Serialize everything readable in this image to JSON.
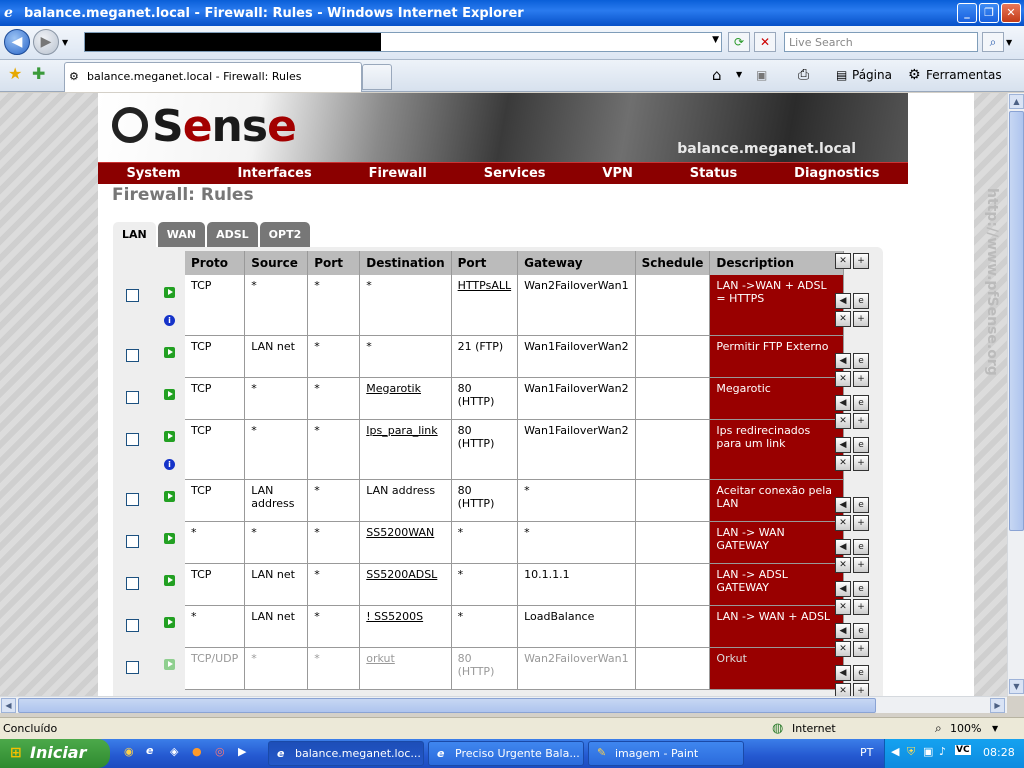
{
  "window": {
    "title": "balance.meganet.local - Firewall: Rules - Windows Internet Explorer",
    "search_placeholder": "Live Search",
    "tab_title": "balance.meganet.local - Firewall: Rules",
    "page_menu": "Página",
    "tools_menu": "Ferramentas"
  },
  "pfsense": {
    "logo_text": "pfSense",
    "hostname": "balance.meganet.local",
    "menu": [
      "System",
      "Interfaces",
      "Firewall",
      "Services",
      "VPN",
      "Status",
      "Diagnostics"
    ],
    "page_title": "Firewall: Rules",
    "watermark": "http://www.pfSense.org",
    "tabs": [
      "LAN",
      "WAN",
      "ADSL",
      "OPT2"
    ],
    "active_tab": "LAN",
    "columns": [
      "Proto",
      "Source",
      "Port",
      "Destination",
      "Port",
      "Gateway",
      "Schedule",
      "Description"
    ],
    "rules": [
      {
        "proto": "TCP",
        "source": "*",
        "sport": "*",
        "dest": "*",
        "dest_link": false,
        "dport": "HTTPsALL",
        "dport_link": true,
        "gateway": "Wan2FailoverWan1",
        "schedule": "",
        "desc": "LAN ->WAN + ADSL = HTTPS",
        "enabled": true,
        "info": true
      },
      {
        "proto": "TCP",
        "source": "LAN net",
        "sport": "*",
        "dest": "*",
        "dest_link": false,
        "dport": "21 (FTP)",
        "dport_link": false,
        "gateway": "Wan1FailoverWan2",
        "schedule": "",
        "desc": "Permitir FTP Externo",
        "enabled": true,
        "info": false
      },
      {
        "proto": "TCP",
        "source": "*",
        "sport": "*",
        "dest": "Megarotik",
        "dest_link": true,
        "dport": "80 (HTTP)",
        "dport_link": false,
        "gateway": "Wan1FailoverWan2",
        "schedule": "",
        "desc": "Megarotic",
        "enabled": true,
        "info": false
      },
      {
        "proto": "TCP",
        "source": "*",
        "sport": "*",
        "dest": "Ips_para_link",
        "dest_link": true,
        "dport": "80 (HTTP)",
        "dport_link": false,
        "gateway": "Wan1FailoverWan2",
        "schedule": "",
        "desc": "Ips redirecinados para um link",
        "enabled": true,
        "info": true
      },
      {
        "proto": "TCP",
        "source": "LAN address",
        "sport": "*",
        "dest": "LAN address",
        "dest_link": false,
        "dport": "80 (HTTP)",
        "dport_link": false,
        "gateway": "*",
        "schedule": "",
        "desc": "Aceitar conexão pela LAN",
        "enabled": true,
        "info": false
      },
      {
        "proto": "*",
        "source": "*",
        "sport": "*",
        "dest": "SS5200WAN",
        "dest_link": true,
        "dport": "*",
        "dport_link": false,
        "gateway": "*",
        "schedule": "",
        "desc": "LAN -> WAN GATEWAY",
        "enabled": true,
        "info": false
      },
      {
        "proto": "TCP",
        "source": "LAN net",
        "sport": "*",
        "dest": "SS5200ADSL",
        "dest_link": true,
        "dport": "*",
        "dport_link": false,
        "gateway": "10.1.1.1",
        "schedule": "",
        "desc": "LAN -> ADSL GATEWAY",
        "enabled": true,
        "info": false
      },
      {
        "proto": "*",
        "source": "LAN net",
        "sport": "*",
        "dest": "! SS5200S",
        "dest_link": true,
        "dport": "*",
        "dport_link": false,
        "gateway": "LoadBalance",
        "schedule": "",
        "desc": "LAN -> WAN + ADSL",
        "enabled": true,
        "info": false
      },
      {
        "proto": "TCP/UDP",
        "source": "*",
        "sport": "*",
        "dest": "orkut",
        "dest_link": true,
        "dport": "80 (HTTP)",
        "dport_link": false,
        "gateway": "Wan2FailoverWan1",
        "schedule": "",
        "desc": "Orkut",
        "enabled": false,
        "info": false
      }
    ]
  },
  "statusbar": {
    "text": "Concluído",
    "zone": "Internet",
    "zoom": "100%"
  },
  "taskbar": {
    "start": "Iniciar",
    "items": [
      "balance.meganet.loc...",
      "Preciso Urgente Bala...",
      "imagem - Paint"
    ],
    "lang": "PT",
    "clock": "08:28"
  }
}
